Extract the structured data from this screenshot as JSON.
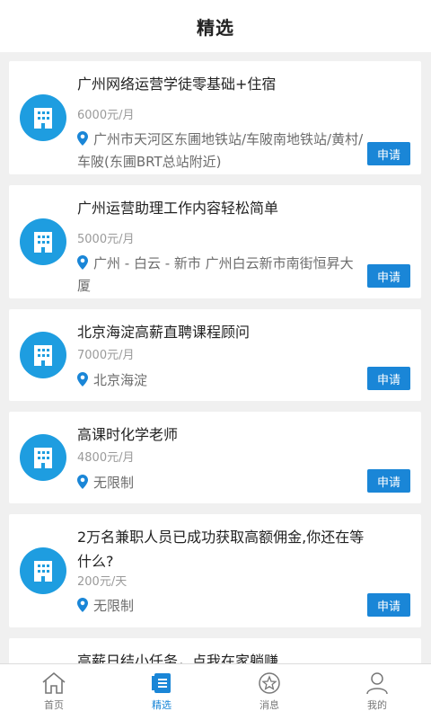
{
  "header": {
    "title": "精选"
  },
  "jobs": [
    {
      "title": "广州网络运营学徒零基础+住宿",
      "salary": "6000元/月",
      "location": "广州市天河区东圃地铁站/车陂南地铁站/黄村/车陂(东圃BRT总站附近)",
      "apply_label": "申请"
    },
    {
      "title": "广州运营助理工作内容轻松简单",
      "salary": "5000元/月",
      "location": "广州 - 白云 - 新市 广州白云新市南街恒昇大厦",
      "apply_label": "申请"
    },
    {
      "title": "北京海淀高薪直聘课程顾问",
      "salary": "7000元/月",
      "location": "北京海淀",
      "apply_label": "申请"
    },
    {
      "title": "高课时化学老师",
      "salary": "4800元/月",
      "location": "无限制",
      "apply_label": "申请"
    },
    {
      "title": "2万名兼职人员已成功获取高额佣金,你还在等什么?",
      "salary": "200元/天",
      "location": "无限制",
      "apply_label": "申请"
    },
    {
      "title": "高薪日结小任务，点我在家躺赚"
    }
  ],
  "tabs": [
    {
      "label": "首页",
      "icon": "home-icon"
    },
    {
      "label": "精选",
      "icon": "list-icon"
    },
    {
      "label": "消息",
      "icon": "star-icon"
    },
    {
      "label": "我的",
      "icon": "user-icon"
    }
  ],
  "colors": {
    "accent": "#1a86d7",
    "avatar": "#1e9de0",
    "background": "#f0f0f0"
  }
}
